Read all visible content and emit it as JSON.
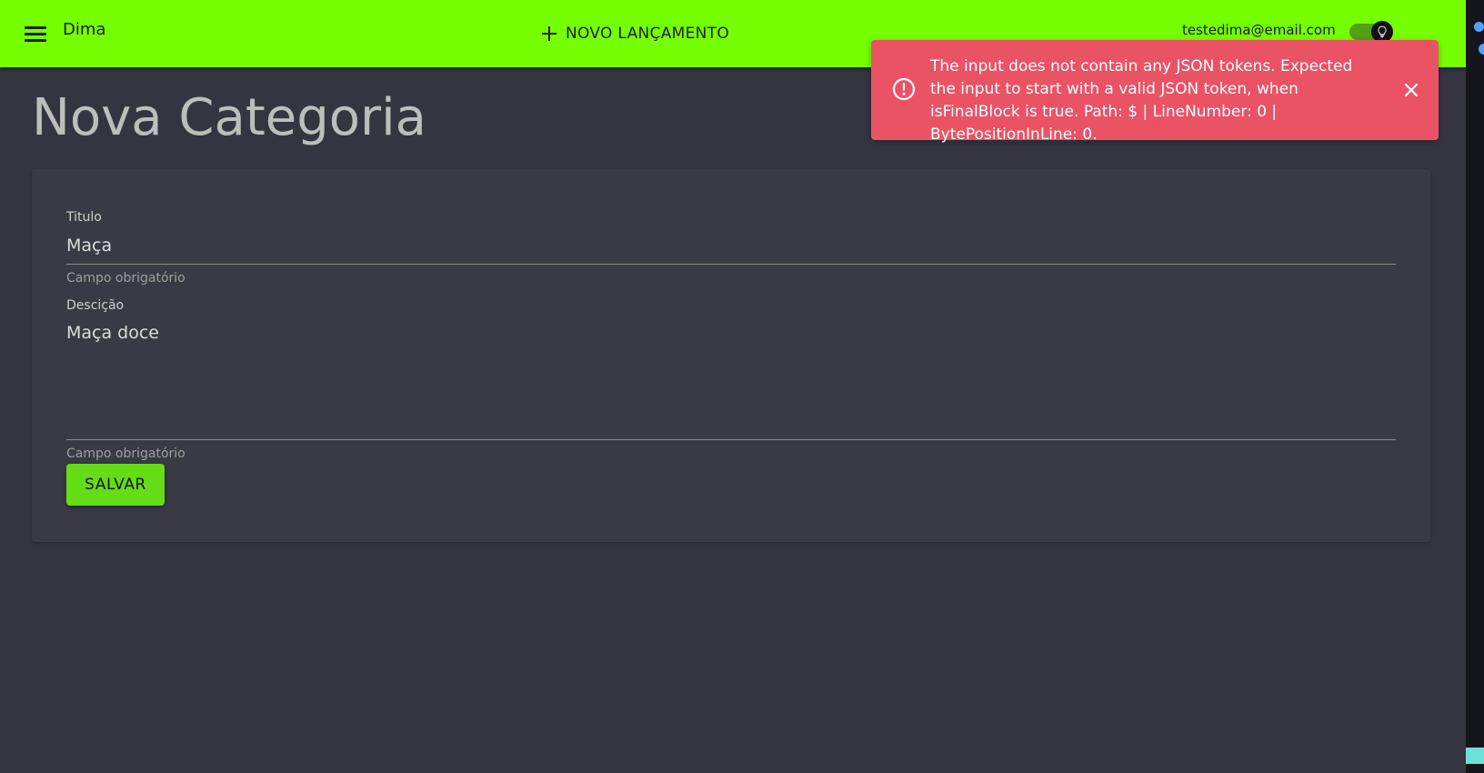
{
  "app": {
    "brand": "Dima",
    "new_entry_label": "NOVO LANÇAMENTO",
    "user_email": "testedima@email.com",
    "theme_toggle_state": "on"
  },
  "page": {
    "title": "Nova Categoria"
  },
  "form": {
    "title_label": "Titulo",
    "title_value": "Maça",
    "title_helper": "Campo obrigatório",
    "description_label": "Descição",
    "description_value": "Maça doce",
    "description_helper": "Campo obrigatório",
    "save_label": "SALVAR"
  },
  "alert": {
    "message": "The input does not contain any JSON tokens. Expected the input to start with a valid JSON token, when isFinalBlock is true. Path: $ | LineNumber: 0 | BytePositionInLine: 0."
  },
  "colors": {
    "appbar": "#76ff03",
    "background": "#343541",
    "card": "#393a45",
    "button": "#64dd17",
    "alert": "#ea5364"
  },
  "icons": {
    "menu": "menu-icon",
    "add": "plus-icon",
    "theme": "lightbulb-icon",
    "error": "error-icon",
    "close": "close-icon"
  }
}
